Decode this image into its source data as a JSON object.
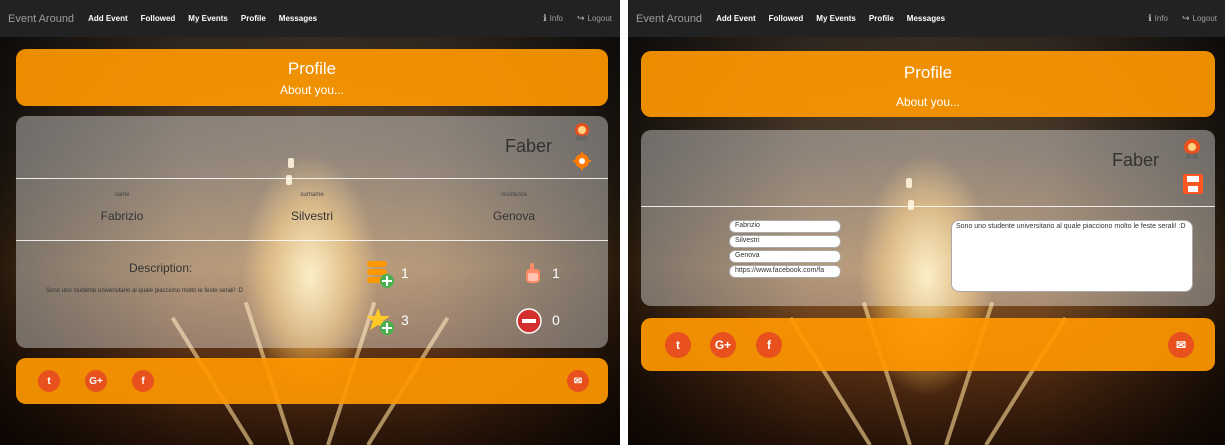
{
  "nav": {
    "brand": "Event Around",
    "items": [
      "Add Event",
      "Followed",
      "My Events",
      "Profile",
      "Messages"
    ],
    "info": "Info",
    "logout": "Logout"
  },
  "header": {
    "title": "Profile",
    "subtitle": "About you..."
  },
  "profile": {
    "username": "Faber",
    "fields": [
      {
        "label": "name",
        "value": "Fabrizio"
      },
      {
        "label": "surname",
        "value": "Silvestri"
      },
      {
        "label": "residence",
        "value": "Genova"
      }
    ],
    "description_label": "Description:",
    "description": "Sono uno studente universitario al quale piacciono molto le feste serali! :D",
    "stats": {
      "created_events": "1",
      "likes": "1",
      "favorites": "3",
      "blocked": "0"
    }
  },
  "edit": {
    "name": "Fabrizio",
    "surname": "Silvestri",
    "residence": "Genova",
    "facebook": "https://www.facebook.com/fa",
    "description": "Sono uno studente universitario al quale piacciono molto le feste serali! :D"
  },
  "footer": {
    "twitter": "t",
    "googleplus": "G+",
    "facebook": "f"
  },
  "colors": {
    "accent": "#ff9800",
    "social": "#e8501e",
    "navbar": "#222222"
  }
}
